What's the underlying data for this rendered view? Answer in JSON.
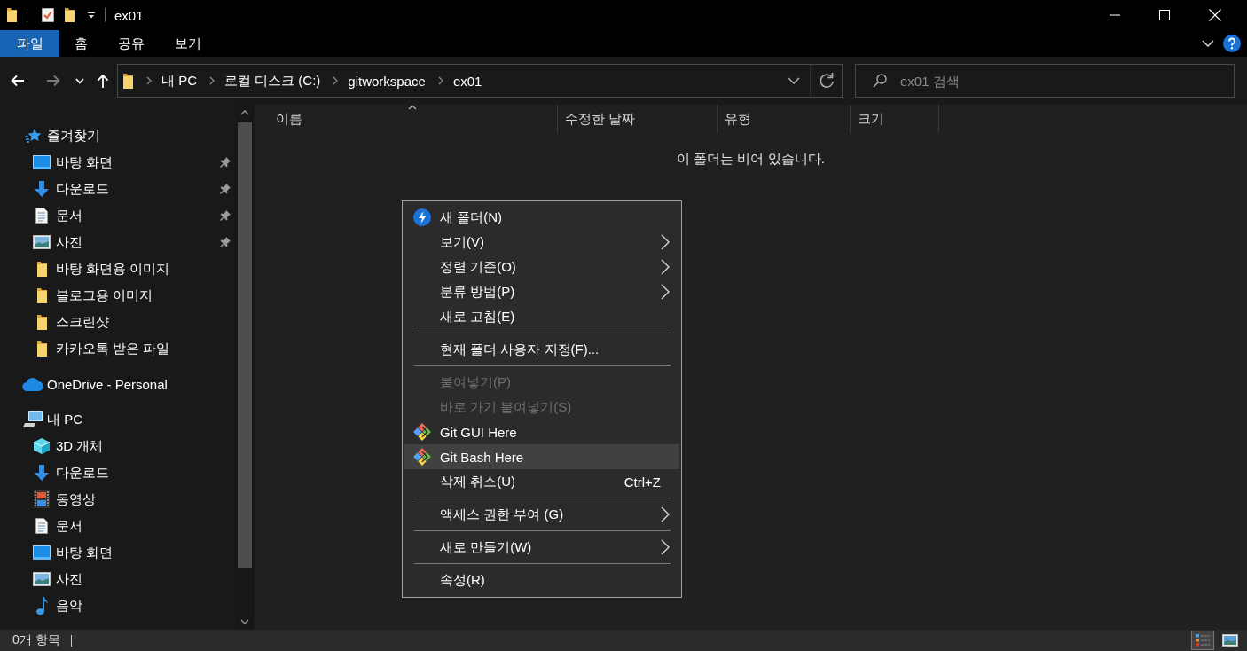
{
  "window": {
    "title": "ex01"
  },
  "ribbon": {
    "tabs": [
      {
        "label": "파일",
        "kind": "file"
      },
      {
        "label": "홈",
        "kind": "tab"
      },
      {
        "label": "공유",
        "kind": "tab"
      },
      {
        "label": "보기",
        "kind": "tab"
      }
    ]
  },
  "navigation": [
    {
      "kind": "back",
      "disabled": false
    },
    {
      "kind": "forward",
      "disabled": true
    },
    {
      "kind": "recent",
      "disabled": false
    },
    {
      "kind": "up",
      "disabled": false
    }
  ],
  "address_bar": {
    "path": [
      "내 PC",
      "로컬 디스크 (C:)",
      "gitworkspace",
      "ex01"
    ],
    "search": {
      "placeholder": "ex01 검색"
    }
  },
  "sidebar": {
    "items": [
      {
        "label": "즐겨찾기",
        "kind": "star",
        "children": [
          {
            "label": "바탕 화면",
            "kind": "desktop",
            "pinned": true
          },
          {
            "label": "다운로드",
            "kind": "download",
            "pinned": true
          },
          {
            "label": "문서",
            "kind": "document",
            "pinned": true
          },
          {
            "label": "사진",
            "kind": "picture",
            "pinned": true
          },
          {
            "label": "바탕 화면용 이미지",
            "kind": "folder",
            "pinned": false
          },
          {
            "label": "블로그용 이미지",
            "kind": "folder",
            "pinned": false
          },
          {
            "label": "스크린샷",
            "kind": "folder",
            "pinned": false
          },
          {
            "label": "카카오톡 받은 파일",
            "kind": "folder",
            "pinned": false
          }
        ]
      },
      {
        "label": "OneDrive - Personal",
        "kind": "cloud"
      },
      {
        "label": "내 PC",
        "kind": "computer",
        "children": [
          {
            "label": "3D 개체",
            "kind": "cube"
          },
          {
            "label": "다운로드",
            "kind": "download"
          },
          {
            "label": "동영상",
            "kind": "video"
          },
          {
            "label": "문서",
            "kind": "document"
          },
          {
            "label": "바탕 화면",
            "kind": "desktop"
          },
          {
            "label": "사진",
            "kind": "picture"
          },
          {
            "label": "음악",
            "kind": "music"
          }
        ]
      }
    ]
  },
  "file_list": {
    "columns": [
      {
        "label": "이름",
        "sorted": true
      },
      {
        "label": "수정한 날짜",
        "sorted": false
      },
      {
        "label": "유형",
        "sorted": false
      },
      {
        "label": "크기",
        "sorted": false
      }
    ],
    "empty_message": "이 폴더는 비어 있습니다."
  },
  "context_menu": {
    "groups": [
      {
        "items": [
          {
            "label": "새 폴더(N)",
            "kind": "bolt",
            "disabled": false,
            "selected": false
          },
          {
            "label": "보기(V)",
            "kind": "submenu",
            "disabled": false,
            "selected": false
          },
          {
            "label": "정렬 기준(O)",
            "kind": "submenu",
            "disabled": false,
            "selected": false
          },
          {
            "label": "분류 방법(P)",
            "kind": "submenu",
            "disabled": false,
            "selected": false
          },
          {
            "label": "새로 고침(E)",
            "kind": "plain",
            "disabled": false,
            "selected": false
          }
        ]
      },
      {
        "items": [
          {
            "label": "현재 폴더 사용자 지정(F)...",
            "kind": "plain",
            "disabled": false,
            "selected": false
          }
        ]
      },
      {
        "items": [
          {
            "label": "붙여넣기(P)",
            "kind": "plain",
            "disabled": true,
            "selected": false
          },
          {
            "label": "바로 가기 붙여넣기(S)",
            "kind": "plain",
            "disabled": true,
            "selected": false
          },
          {
            "label": "Git GUI Here",
            "kind": "git",
            "disabled": false,
            "selected": false
          },
          {
            "label": "Git Bash Here",
            "kind": "git",
            "disabled": false,
            "selected": true
          },
          {
            "label": "삭제 취소(U)",
            "kind": "plain",
            "disabled": false,
            "selected": false,
            "shortcut": "Ctrl+Z"
          }
        ]
      },
      {
        "items": [
          {
            "label": "액세스 권한 부여 (G)",
            "kind": "submenu",
            "disabled": false,
            "selected": false
          }
        ]
      },
      {
        "items": [
          {
            "label": "새로 만들기(W)",
            "kind": "submenu",
            "disabled": false,
            "selected": false
          }
        ]
      },
      {
        "items": [
          {
            "label": "속성(R)",
            "kind": "plain",
            "disabled": false,
            "selected": false
          }
        ]
      }
    ]
  },
  "status_bar": {
    "item_count": "0개 항목",
    "views": [
      {
        "kind": "details",
        "selected": true
      },
      {
        "kind": "large-icons",
        "selected": false
      }
    ]
  }
}
